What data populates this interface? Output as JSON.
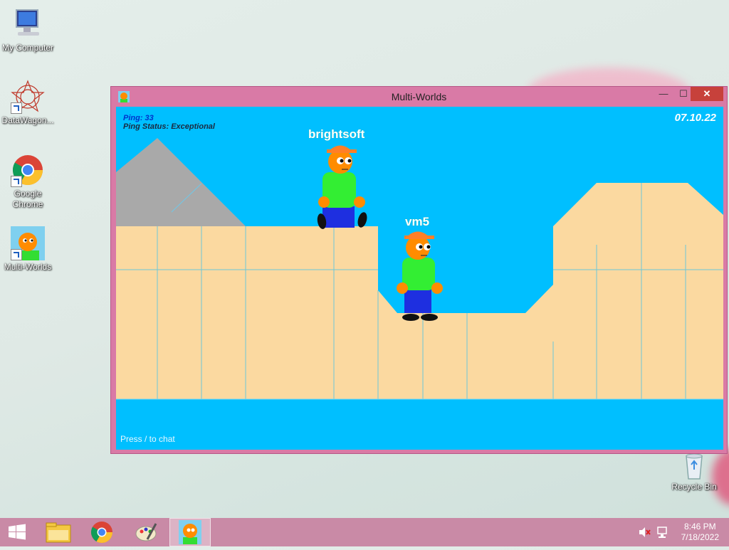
{
  "desktop": {
    "icons": [
      {
        "label": "My Computer",
        "icon": "computer-icon"
      },
      {
        "label": "DataWagon...",
        "icon": "datawagon-icon"
      },
      {
        "label": "Google Chrome",
        "icon": "chrome-icon"
      },
      {
        "label": "Multi-Worlds",
        "icon": "multiworlds-icon"
      },
      {
        "label": "Recycle Bin",
        "icon": "recycle-bin-icon"
      }
    ]
  },
  "window": {
    "title": "Multi-Worlds",
    "controls": {
      "minimize": "—",
      "maximize": "☐",
      "close": "✕"
    }
  },
  "game": {
    "ping": "Ping: 33",
    "ping_status": "Ping Status: Exceptional",
    "date": "07.10.22",
    "players": [
      {
        "name": "brightsoft"
      },
      {
        "name": "vm5"
      }
    ],
    "chat_hint": "Press / to chat",
    "colors": {
      "sky": "#00bfff",
      "sand": "#fbd9a0",
      "rock": "#a9a9a9",
      "hud_blue": "#0033cc"
    }
  },
  "taskbar": {
    "clock": {
      "time": "8:46 PM",
      "date": "7/18/2022"
    },
    "apps": [
      "start-icon",
      "file-explorer-icon",
      "chrome-icon",
      "paint-icon",
      "multiworlds-icon"
    ]
  }
}
